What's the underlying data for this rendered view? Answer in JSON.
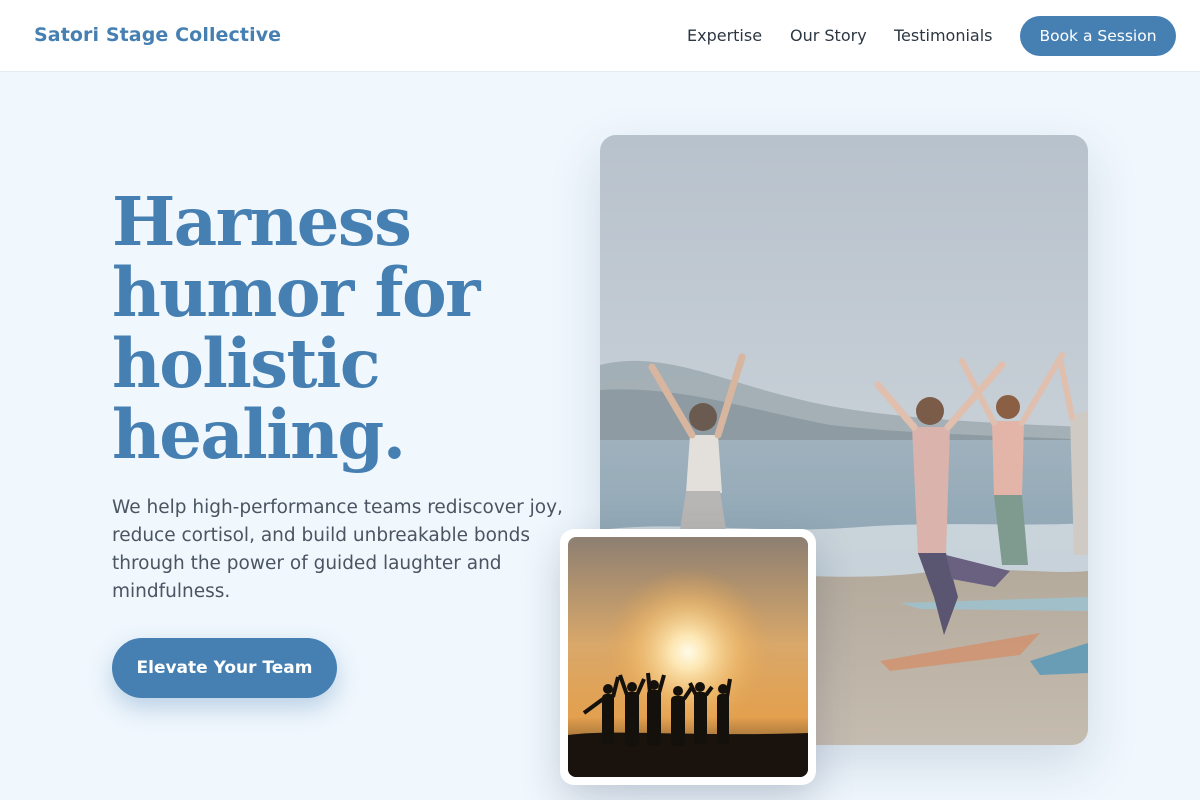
{
  "header": {
    "brand": "Satori Stage Collective",
    "nav": {
      "expertise": "Expertise",
      "story": "Our Story",
      "testimonials": "Testimonials"
    },
    "cta": "Book a Session"
  },
  "hero": {
    "heading_lines": [
      "Harness",
      "humor for",
      "holistic",
      "healing."
    ],
    "subtext": "We help high-performance teams rediscover joy, reduce cortisol, and build unbreakable bonds through the power of guided laughter and mindfulness.",
    "cta": "Elevate Your Team"
  },
  "images": {
    "main": "beach-yoga-group-photo",
    "inset": "sunset-silhouette-group-photo"
  },
  "colors": {
    "accent": "#4680b3",
    "background": "#f0f7fd",
    "text": "#2d3742"
  }
}
